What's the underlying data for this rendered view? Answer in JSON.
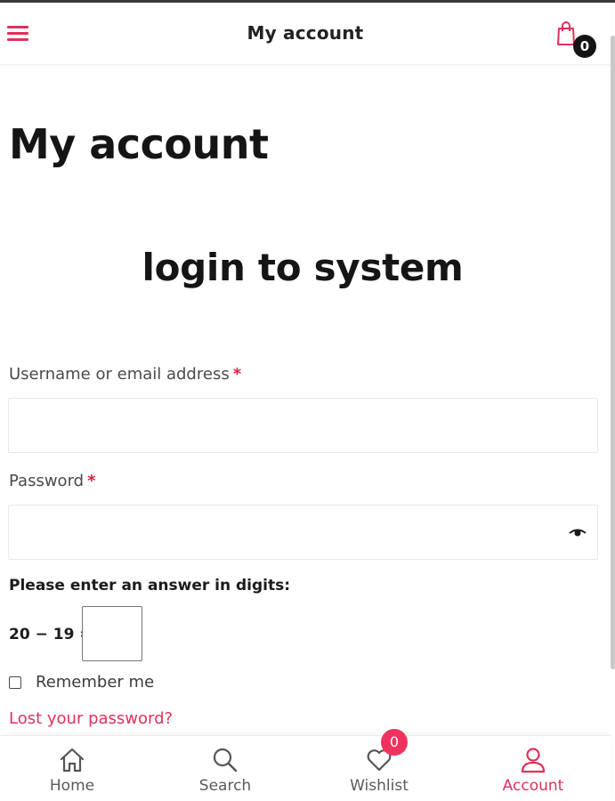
{
  "header": {
    "title": "My account",
    "cart_count": "0",
    "menu_icon": "hamburger-menu-icon",
    "cart_icon": "shopping-bag-icon"
  },
  "main": {
    "page_title": "My account",
    "login_heading": "login to system",
    "form": {
      "username_label": "Username or email address",
      "password_label": "Password",
      "required_mark": "*",
      "username_value": "",
      "password_value": "",
      "captcha_prompt": "Please enter an answer in digits:",
      "captcha_equation": "20 − 19 =",
      "captcha_value": "",
      "remember_label": "Remember me",
      "remember_checked": false,
      "lost_password_link": "Lost your password?"
    }
  },
  "bottom_nav": {
    "items": [
      {
        "label": "Home",
        "icon": "home-icon"
      },
      {
        "label": "Search",
        "icon": "search-icon"
      },
      {
        "label": "Wishlist",
        "icon": "heart-icon",
        "badge": "0"
      },
      {
        "label": "Account",
        "icon": "user-icon",
        "active": true
      }
    ]
  },
  "colors": {
    "accent": "#e0315b",
    "badge": "#f0335e",
    "text": "#1b1b1b"
  }
}
